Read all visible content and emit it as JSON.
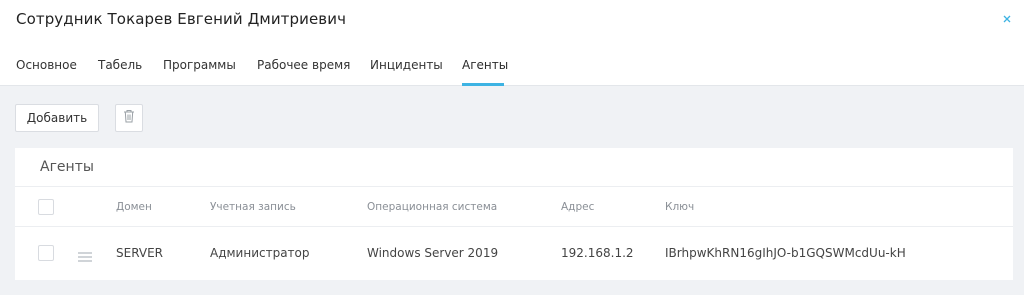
{
  "window": {
    "title": "Сотрудник Токарев Евгений Дмитриевич",
    "close_icon": "close-icon"
  },
  "tabs": [
    {
      "label": "Основное",
      "active": false
    },
    {
      "label": "Табель",
      "active": false
    },
    {
      "label": "Программы",
      "active": false
    },
    {
      "label": "Рабочее время",
      "active": false
    },
    {
      "label": "Инциденты",
      "active": false
    },
    {
      "label": "Агенты",
      "active": true
    }
  ],
  "toolbar": {
    "add_label": "Добавить",
    "delete_icon": "trash-icon"
  },
  "agents": {
    "title": "Агенты",
    "columns": [
      "Домен",
      "Учетная запись",
      "Операционная система",
      "Адрес",
      "Ключ"
    ],
    "rows": [
      {
        "domain": "SERVER",
        "account": "Администратор",
        "os": "Windows Server 2019",
        "address": "192.168.1.2",
        "key": "IBrhpwKhRN16gIhJO-b1GQSWMcdUu-kH",
        "checked": false
      }
    ]
  },
  "colors": {
    "accent": "#3db3e3",
    "background": "#f0f2f5"
  }
}
